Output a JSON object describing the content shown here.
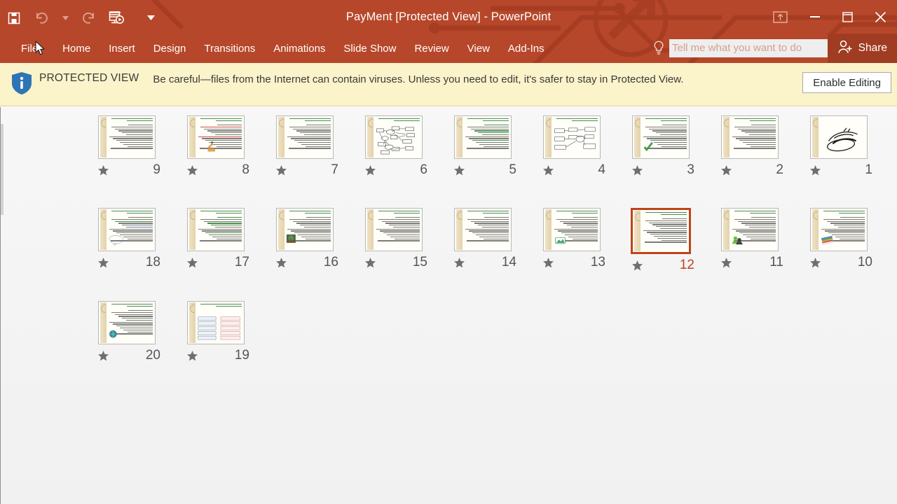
{
  "window": {
    "title": "PayMent [Protected View] - PowerPoint",
    "accent_color": "#b7472a",
    "share_bg": "#a03c22",
    "controls": [
      {
        "name": "ribbon-display-options",
        "label": "Ribbon Display Options"
      },
      {
        "name": "minimize",
        "label": "Minimize"
      },
      {
        "name": "restore",
        "label": "Restore Down"
      },
      {
        "name": "close",
        "label": "Close"
      }
    ]
  },
  "quick_access": [
    {
      "name": "save",
      "label": "Save",
      "enabled": true
    },
    {
      "name": "undo",
      "label": "Undo",
      "enabled": false
    },
    {
      "name": "undo-dropdown",
      "label": "Undo options",
      "enabled": false
    },
    {
      "name": "redo",
      "label": "Repeat",
      "enabled": false
    },
    {
      "name": "start-slideshow",
      "label": "Start From Beginning",
      "enabled": true
    },
    {
      "name": "customize-qat",
      "label": "Customize Quick Access Toolbar",
      "enabled": true
    }
  ],
  "ribbon": {
    "tabs": [
      {
        "label": "File"
      },
      {
        "label": "Home"
      },
      {
        "label": "Insert"
      },
      {
        "label": "Design"
      },
      {
        "label": "Transitions"
      },
      {
        "label": "Animations"
      },
      {
        "label": "Slide Show"
      },
      {
        "label": "Review"
      },
      {
        "label": "View"
      },
      {
        "label": "Add-Ins"
      }
    ],
    "tell_me": {
      "value": "",
      "placeholder": "Tell me what you want to do"
    },
    "share_label": "Share"
  },
  "protected_view": {
    "badge": "PROTECTED VIEW",
    "message": "Be careful—files from the Internet can contain viruses. Unless you need to edit, it's safer to stay in Protected View.",
    "button": "Enable Editing",
    "background": "#fbf3c9"
  },
  "slide_sorter": {
    "selected_slide": 12,
    "selection_color": "#c0431a",
    "rows": [
      [
        {
          "number": "9",
          "kind": "text"
        },
        {
          "number": "8",
          "kind": "text-redlist-clipart"
        },
        {
          "number": "7",
          "kind": "text"
        },
        {
          "number": "6",
          "kind": "diagram-network"
        },
        {
          "number": "5",
          "kind": "text-bullets"
        },
        {
          "number": "4",
          "kind": "diagram-boxes"
        },
        {
          "number": "3",
          "kind": "text-checkmark"
        },
        {
          "number": "2",
          "kind": "text-list"
        },
        {
          "number": "1",
          "kind": "calligraphy"
        }
      ],
      [
        {
          "number": "18",
          "kind": "text-callout"
        },
        {
          "number": "17",
          "kind": "text-green"
        },
        {
          "number": "16",
          "kind": "text-photo"
        },
        {
          "number": "15",
          "kind": "text"
        },
        {
          "number": "14",
          "kind": "text"
        },
        {
          "number": "13",
          "kind": "text-image-icon"
        },
        {
          "number": "12",
          "kind": "text",
          "selected": true
        },
        {
          "number": "11",
          "kind": "text-people-icon"
        },
        {
          "number": "10",
          "kind": "text-books-icon"
        }
      ],
      [
        {
          "number": "20",
          "kind": "text-globe-icon"
        },
        {
          "number": "19",
          "kind": "diagram-table"
        }
      ]
    ]
  }
}
